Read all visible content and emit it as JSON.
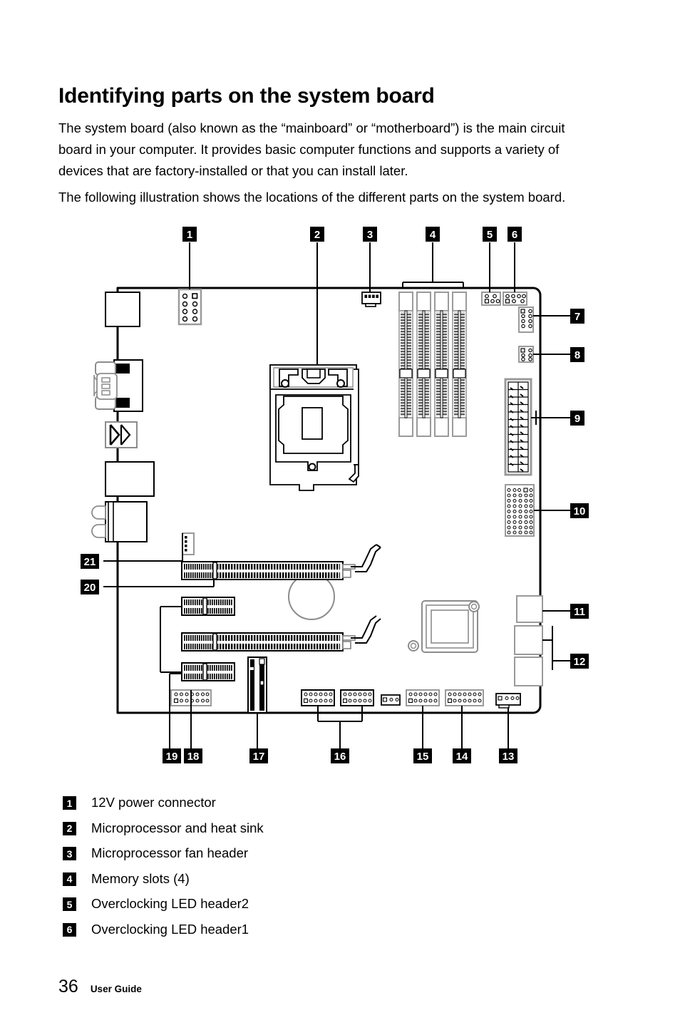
{
  "document": {
    "heading": "Identifying parts on the system board",
    "paragraphs": [
      "The system board (also known as the “mainboard” or “motherboard”) is the main circuit board in your computer. It provides basic computer functions and supports a variety of devices that are factory-installed or that you can install later.",
      "The following illustration shows the locations of the different parts on the system board."
    ]
  },
  "figure": {
    "name": "system-board-diagram",
    "callouts": {
      "top": [
        "1",
        "2",
        "3",
        "4",
        "5",
        "6"
      ],
      "right": [
        "7",
        "8",
        "9",
        "10",
        "11",
        "12"
      ],
      "bottom": [
        "19",
        "18",
        "17",
        "16",
        "15",
        "14",
        "13"
      ],
      "left": [
        "21",
        "20"
      ]
    }
  },
  "parts": [
    {
      "num": "1",
      "label": "12V power connector"
    },
    {
      "num": "2",
      "label": "Microprocessor and heat sink"
    },
    {
      "num": "3",
      "label": "Microprocessor fan header"
    },
    {
      "num": "4",
      "label": "Memory slots (4)"
    },
    {
      "num": "5",
      "label": "Overclocking LED header2"
    },
    {
      "num": "6",
      "label": "Overclocking LED header1"
    }
  ],
  "footer": {
    "page_number": "36",
    "text": "User Guide"
  },
  "colors": {
    "ink": "#000000",
    "paper": "#ffffff",
    "plastic": "#9a9a9a",
    "contact": "#6f6f6f"
  }
}
